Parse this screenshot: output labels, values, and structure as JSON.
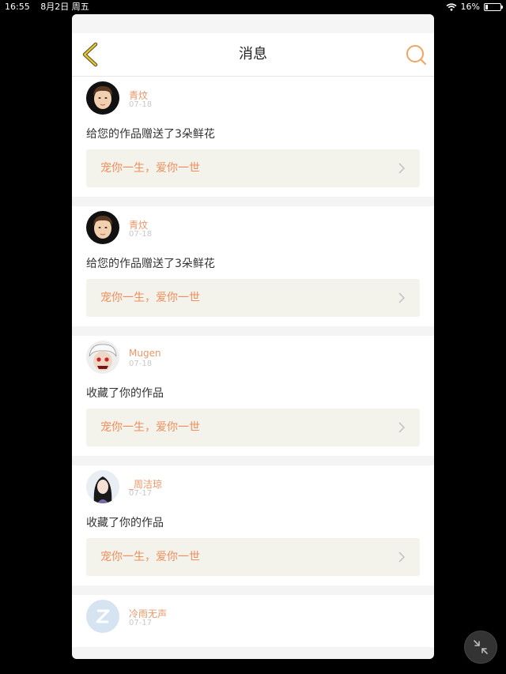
{
  "status": {
    "time": "16:55",
    "date": "8月2日 周五",
    "battery": "16%",
    "battery_level": 0.16
  },
  "nav": {
    "title": "消息"
  },
  "messages": [
    {
      "user": "青炆",
      "date": "07-18",
      "text": "给您的作品赠送了3朵鲜花",
      "work": "宠你一生，爱你一世",
      "avatar": "male"
    },
    {
      "user": "青炆",
      "date": "07-18",
      "text": "给您的作品赠送了3朵鲜花",
      "work": "宠你一生，爱你一世",
      "avatar": "male"
    },
    {
      "user": "Mugen",
      "date": "07-18",
      "text": "收藏了你的作品",
      "work": "宠你一生，爱你一世",
      "avatar": "anime"
    },
    {
      "user": "_周洁琼",
      "date": "07-17",
      "text": "收藏了你的作品",
      "work": "宠你一生，爱你一世",
      "avatar": "female"
    },
    {
      "user": "冷雨无声",
      "date": "07-17",
      "avatar": "default"
    }
  ]
}
